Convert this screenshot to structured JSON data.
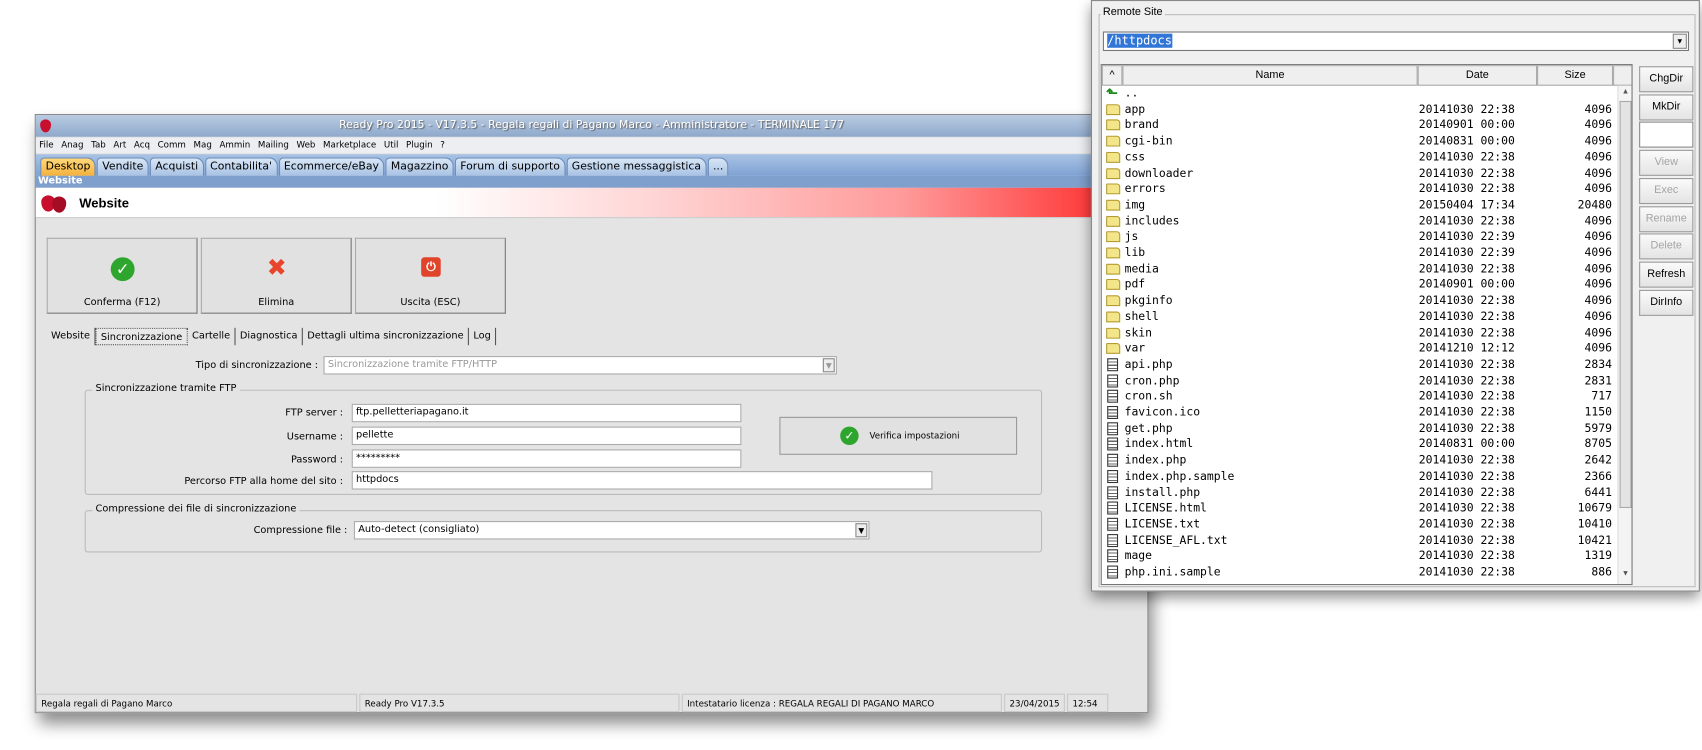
{
  "main_window": {
    "title": "Ready Pro 2015 - V17.3.5 - Regala regali di Pagano Marco - Amministratore - TERMINALE 177",
    "menu": [
      "File",
      "Anag",
      "Tab",
      "Art",
      "Acq",
      "Comm",
      "Mag",
      "Ammin",
      "Mailing",
      "Web",
      "Marketplace",
      "Util",
      "Plugin",
      "?"
    ],
    "tabs": [
      "Desktop",
      "Vendite",
      "Acquisti",
      "Contabilita'",
      "Ecommerce/eBay",
      "Magazzino",
      "Forum di supporto",
      "Gestione messaggistica",
      "..."
    ],
    "section": "Website",
    "header_title": "Website",
    "buttons": {
      "confirm": "Conferma (F12)",
      "delete": "Elimina",
      "exit": "Uscita (ESC)"
    },
    "subtabs": [
      "Website",
      "Sincronizzazione",
      "Cartelle",
      "Diagnostica",
      "Dettagli ultima sincronizzazione",
      "Log"
    ],
    "sync_type_label": "Tipo di sincronizzazione :",
    "sync_type_value": "Sincronizzazione tramite FTP/HTTP",
    "ftp_group": "Sincronizzazione tramite FTP",
    "ftp_server_label": "FTP server :",
    "ftp_server": "ftp.pelletteriapagano.it",
    "username_label": "Username :",
    "username": "pellette",
    "password_label": "Password :",
    "password": "*********",
    "path_label": "Percorso FTP alla home del sito :",
    "path": "httpdocs",
    "verify_button": "Verifica impostazioni",
    "compression_group": "Compressione dei file di sincronizzazione",
    "compression_label": "Compressione file :",
    "compression_value": "Auto-detect (consigliato)",
    "status": [
      "Regala regali di Pagano Marco",
      "Ready Pro V17.3.5",
      "Intestatario licenza : REGALA REGALI DI PAGANO MARCO",
      "23/04/2015",
      "12:54"
    ]
  },
  "remote": {
    "group_label": "Remote Site",
    "path": "/httpdocs",
    "columns": {
      "sort": "^",
      "name": "Name",
      "date": "Date",
      "size": "Size"
    },
    "up": "..",
    "files": [
      {
        "t": "folder",
        "n": "app",
        "d": "20141030 22:38",
        "s": "4096"
      },
      {
        "t": "folder",
        "n": "brand",
        "d": "20140901 00:00",
        "s": "4096"
      },
      {
        "t": "folder",
        "n": "cgi-bin",
        "d": "20140831 00:00",
        "s": "4096"
      },
      {
        "t": "folder",
        "n": "css",
        "d": "20141030 22:38",
        "s": "4096"
      },
      {
        "t": "folder",
        "n": "downloader",
        "d": "20141030 22:38",
        "s": "4096"
      },
      {
        "t": "folder",
        "n": "errors",
        "d": "20141030 22:38",
        "s": "4096"
      },
      {
        "t": "folder",
        "n": "img",
        "d": "20150404 17:34",
        "s": "20480"
      },
      {
        "t": "folder",
        "n": "includes",
        "d": "20141030 22:38",
        "s": "4096"
      },
      {
        "t": "folder",
        "n": "js",
        "d": "20141030 22:39",
        "s": "4096"
      },
      {
        "t": "folder",
        "n": "lib",
        "d": "20141030 22:39",
        "s": "4096"
      },
      {
        "t": "folder",
        "n": "media",
        "d": "20141030 22:38",
        "s": "4096"
      },
      {
        "t": "folder",
        "n": "pdf",
        "d": "20140901 00:00",
        "s": "4096"
      },
      {
        "t": "folder",
        "n": "pkginfo",
        "d": "20141030 22:38",
        "s": "4096"
      },
      {
        "t": "folder",
        "n": "shell",
        "d": "20141030 22:38",
        "s": "4096"
      },
      {
        "t": "folder",
        "n": "skin",
        "d": "20141030 22:38",
        "s": "4096"
      },
      {
        "t": "folder",
        "n": "var",
        "d": "20141210 12:12",
        "s": "4096"
      },
      {
        "t": "file",
        "n": "api.php",
        "d": "20141030 22:38",
        "s": "2834"
      },
      {
        "t": "file",
        "n": "cron.php",
        "d": "20141030 22:38",
        "s": "2831"
      },
      {
        "t": "file",
        "n": "cron.sh",
        "d": "20141030 22:38",
        "s": "717"
      },
      {
        "t": "file",
        "n": "favicon.ico",
        "d": "20141030 22:38",
        "s": "1150"
      },
      {
        "t": "file",
        "n": "get.php",
        "d": "20141030 22:38",
        "s": "5979"
      },
      {
        "t": "file",
        "n": "index.html",
        "d": "20140831 00:00",
        "s": "8705"
      },
      {
        "t": "file",
        "n": "index.php",
        "d": "20141030 22:38",
        "s": "2642"
      },
      {
        "t": "file",
        "n": "index.php.sample",
        "d": "20141030 22:38",
        "s": "2366"
      },
      {
        "t": "file",
        "n": "install.php",
        "d": "20141030 22:38",
        "s": "6441"
      },
      {
        "t": "file",
        "n": "LICENSE.html",
        "d": "20141030 22:38",
        "s": "10679"
      },
      {
        "t": "file",
        "n": "LICENSE.txt",
        "d": "20141030 22:38",
        "s": "10410"
      },
      {
        "t": "file",
        "n": "LICENSE_AFL.txt",
        "d": "20141030 22:38",
        "s": "10421"
      },
      {
        "t": "file",
        "n": "mage",
        "d": "20141030 22:38",
        "s": "1319"
      },
      {
        "t": "file",
        "n": "php.ini.sample",
        "d": "20141030 22:38",
        "s": "886"
      }
    ],
    "buttons": [
      {
        "l": "ChgDir",
        "e": true
      },
      {
        "l": "MkDir",
        "e": true
      },
      {
        "l": "View",
        "e": false
      },
      {
        "l": "Exec",
        "e": false
      },
      {
        "l": "Rename",
        "e": false
      },
      {
        "l": "Delete",
        "e": false
      },
      {
        "l": "Refresh",
        "e": true
      },
      {
        "l": "DirInfo",
        "e": true
      }
    ]
  },
  "colors": {
    "accent": "#3175d6",
    "titlebar": "#8fa9cc",
    "active_tab": "#f4b13c"
  }
}
